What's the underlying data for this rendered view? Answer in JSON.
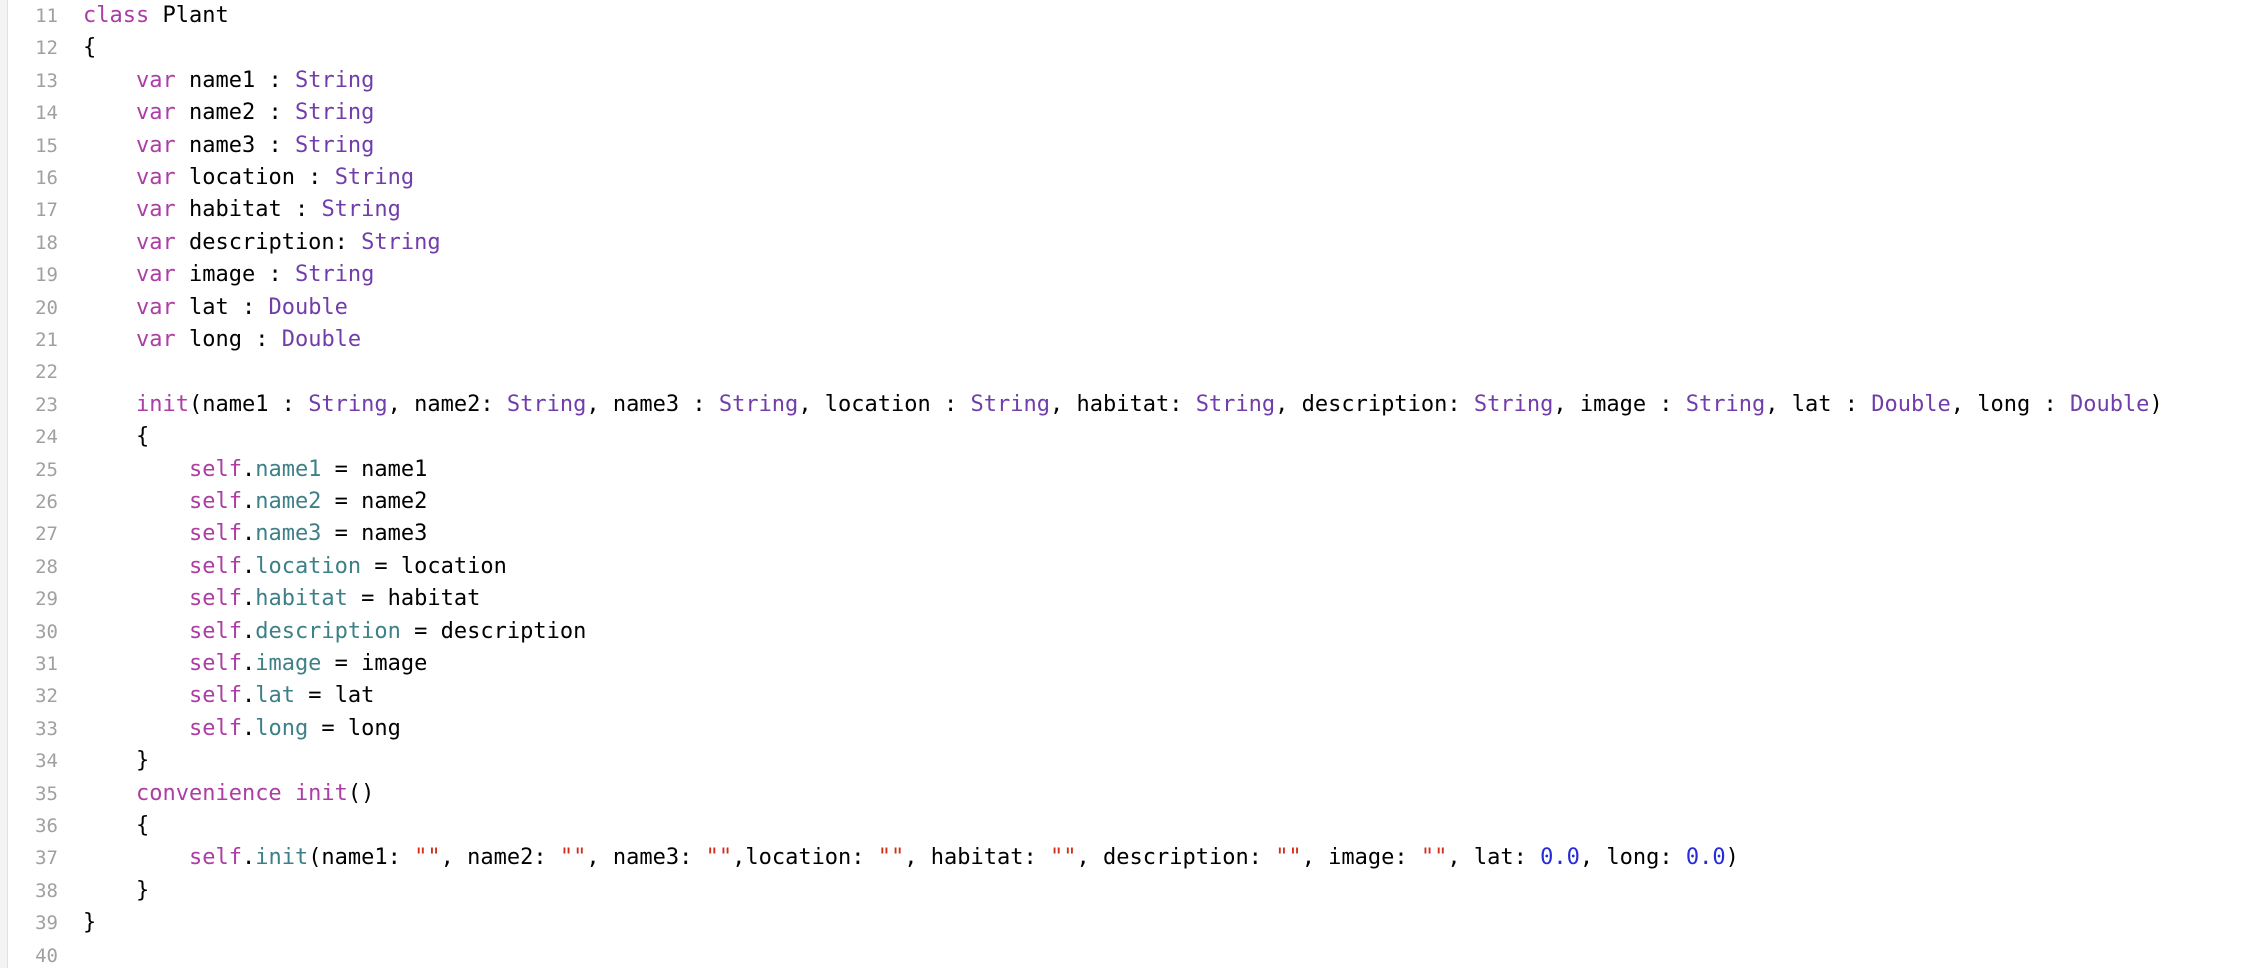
{
  "editor": {
    "colors": {
      "keyword": "#ad3da4",
      "type": "#703daa",
      "property": "#3e8087",
      "string": "#d12f1b",
      "number": "#272ad8",
      "plain": "#000000",
      "line_number": "#a0a0a0",
      "background": "#ffffff"
    },
    "lines": [
      {
        "num": "11",
        "indent": 0,
        "tokens": [
          {
            "t": "class",
            "c": "kw"
          },
          {
            "t": " Plant",
            "c": "pl"
          }
        ]
      },
      {
        "num": "12",
        "indent": 0,
        "tokens": [
          {
            "t": "{",
            "c": "pl"
          }
        ]
      },
      {
        "num": "13",
        "indent": 1,
        "tokens": [
          {
            "t": "var",
            "c": "kw"
          },
          {
            "t": " name1 : ",
            "c": "pl"
          },
          {
            "t": "String",
            "c": "ty"
          }
        ]
      },
      {
        "num": "14",
        "indent": 1,
        "tokens": [
          {
            "t": "var",
            "c": "kw"
          },
          {
            "t": " name2 : ",
            "c": "pl"
          },
          {
            "t": "String",
            "c": "ty"
          }
        ]
      },
      {
        "num": "15",
        "indent": 1,
        "tokens": [
          {
            "t": "var",
            "c": "kw"
          },
          {
            "t": " name3 : ",
            "c": "pl"
          },
          {
            "t": "String",
            "c": "ty"
          }
        ]
      },
      {
        "num": "16",
        "indent": 1,
        "tokens": [
          {
            "t": "var",
            "c": "kw"
          },
          {
            "t": " location : ",
            "c": "pl"
          },
          {
            "t": "String",
            "c": "ty"
          }
        ]
      },
      {
        "num": "17",
        "indent": 1,
        "tokens": [
          {
            "t": "var",
            "c": "kw"
          },
          {
            "t": " habitat : ",
            "c": "pl"
          },
          {
            "t": "String",
            "c": "ty"
          }
        ]
      },
      {
        "num": "18",
        "indent": 1,
        "tokens": [
          {
            "t": "var",
            "c": "kw"
          },
          {
            "t": " description: ",
            "c": "pl"
          },
          {
            "t": "String",
            "c": "ty"
          }
        ]
      },
      {
        "num": "19",
        "indent": 1,
        "tokens": [
          {
            "t": "var",
            "c": "kw"
          },
          {
            "t": " image : ",
            "c": "pl"
          },
          {
            "t": "String",
            "c": "ty"
          }
        ]
      },
      {
        "num": "20",
        "indent": 1,
        "tokens": [
          {
            "t": "var",
            "c": "kw"
          },
          {
            "t": " lat : ",
            "c": "pl"
          },
          {
            "t": "Double",
            "c": "ty"
          }
        ]
      },
      {
        "num": "21",
        "indent": 1,
        "tokens": [
          {
            "t": "var",
            "c": "kw"
          },
          {
            "t": " long : ",
            "c": "pl"
          },
          {
            "t": "Double",
            "c": "ty"
          }
        ]
      },
      {
        "num": "22",
        "indent": 0,
        "tokens": []
      },
      {
        "num": "23",
        "indent": 1,
        "tokens": [
          {
            "t": "init",
            "c": "kw"
          },
          {
            "t": "(name1 : ",
            "c": "pl"
          },
          {
            "t": "String",
            "c": "ty"
          },
          {
            "t": ", name2: ",
            "c": "pl"
          },
          {
            "t": "String",
            "c": "ty"
          },
          {
            "t": ", name3 : ",
            "c": "pl"
          },
          {
            "t": "String",
            "c": "ty"
          },
          {
            "t": ", location : ",
            "c": "pl"
          },
          {
            "t": "String",
            "c": "ty"
          },
          {
            "t": ", habitat: ",
            "c": "pl"
          },
          {
            "t": "String",
            "c": "ty"
          },
          {
            "t": ", description: ",
            "c": "pl"
          },
          {
            "t": "String",
            "c": "ty"
          },
          {
            "t": ", image : ",
            "c": "pl"
          },
          {
            "t": "String",
            "c": "ty"
          },
          {
            "t": ", lat : ",
            "c": "pl"
          },
          {
            "t": "Double",
            "c": "ty"
          },
          {
            "t": ", long : ",
            "c": "pl"
          },
          {
            "t": "Double",
            "c": "ty"
          },
          {
            "t": ")",
            "c": "pl"
          }
        ]
      },
      {
        "num": "24",
        "indent": 1,
        "tokens": [
          {
            "t": "{",
            "c": "pl"
          }
        ]
      },
      {
        "num": "25",
        "indent": 2,
        "tokens": [
          {
            "t": "self",
            "c": "kw"
          },
          {
            "t": ".",
            "c": "pl"
          },
          {
            "t": "name1",
            "c": "pr"
          },
          {
            "t": " = name1",
            "c": "pl"
          }
        ]
      },
      {
        "num": "26",
        "indent": 2,
        "tokens": [
          {
            "t": "self",
            "c": "kw"
          },
          {
            "t": ".",
            "c": "pl"
          },
          {
            "t": "name2",
            "c": "pr"
          },
          {
            "t": " = name2",
            "c": "pl"
          }
        ]
      },
      {
        "num": "27",
        "indent": 2,
        "tokens": [
          {
            "t": "self",
            "c": "kw"
          },
          {
            "t": ".",
            "c": "pl"
          },
          {
            "t": "name3",
            "c": "pr"
          },
          {
            "t": " = name3",
            "c": "pl"
          }
        ]
      },
      {
        "num": "28",
        "indent": 2,
        "tokens": [
          {
            "t": "self",
            "c": "kw"
          },
          {
            "t": ".",
            "c": "pl"
          },
          {
            "t": "location",
            "c": "pr"
          },
          {
            "t": " = location",
            "c": "pl"
          }
        ]
      },
      {
        "num": "29",
        "indent": 2,
        "tokens": [
          {
            "t": "self",
            "c": "kw"
          },
          {
            "t": ".",
            "c": "pl"
          },
          {
            "t": "habitat",
            "c": "pr"
          },
          {
            "t": " = habitat",
            "c": "pl"
          }
        ]
      },
      {
        "num": "30",
        "indent": 2,
        "tokens": [
          {
            "t": "self",
            "c": "kw"
          },
          {
            "t": ".",
            "c": "pl"
          },
          {
            "t": "description",
            "c": "pr"
          },
          {
            "t": " = description",
            "c": "pl"
          }
        ]
      },
      {
        "num": "31",
        "indent": 2,
        "tokens": [
          {
            "t": "self",
            "c": "kw"
          },
          {
            "t": ".",
            "c": "pl"
          },
          {
            "t": "image",
            "c": "pr"
          },
          {
            "t": " = image",
            "c": "pl"
          }
        ]
      },
      {
        "num": "32",
        "indent": 2,
        "tokens": [
          {
            "t": "self",
            "c": "kw"
          },
          {
            "t": ".",
            "c": "pl"
          },
          {
            "t": "lat",
            "c": "pr"
          },
          {
            "t": " = lat",
            "c": "pl"
          }
        ]
      },
      {
        "num": "33",
        "indent": 2,
        "tokens": [
          {
            "t": "self",
            "c": "kw"
          },
          {
            "t": ".",
            "c": "pl"
          },
          {
            "t": "long",
            "c": "pr"
          },
          {
            "t": " = long",
            "c": "pl"
          }
        ]
      },
      {
        "num": "34",
        "indent": 1,
        "tokens": [
          {
            "t": "}",
            "c": "pl"
          }
        ]
      },
      {
        "num": "35",
        "indent": 1,
        "tokens": [
          {
            "t": "convenience",
            "c": "kw"
          },
          {
            "t": " ",
            "c": "pl"
          },
          {
            "t": "init",
            "c": "kw"
          },
          {
            "t": "()",
            "c": "pl"
          }
        ]
      },
      {
        "num": "36",
        "indent": 1,
        "tokens": [
          {
            "t": "{",
            "c": "pl"
          }
        ]
      },
      {
        "num": "37",
        "indent": 2,
        "tokens": [
          {
            "t": "self",
            "c": "kw"
          },
          {
            "t": ".",
            "c": "pl"
          },
          {
            "t": "init",
            "c": "pr"
          },
          {
            "t": "(name1: ",
            "c": "pl"
          },
          {
            "t": "\"\"",
            "c": "st"
          },
          {
            "t": ", name2: ",
            "c": "pl"
          },
          {
            "t": "\"\"",
            "c": "st"
          },
          {
            "t": ", name3: ",
            "c": "pl"
          },
          {
            "t": "\"\"",
            "c": "st"
          },
          {
            "t": ",location: ",
            "c": "pl"
          },
          {
            "t": "\"\"",
            "c": "st"
          },
          {
            "t": ", habitat: ",
            "c": "pl"
          },
          {
            "t": "\"\"",
            "c": "st"
          },
          {
            "t": ", description: ",
            "c": "pl"
          },
          {
            "t": "\"\"",
            "c": "st"
          },
          {
            "t": ", image: ",
            "c": "pl"
          },
          {
            "t": "\"\"",
            "c": "st"
          },
          {
            "t": ", lat: ",
            "c": "pl"
          },
          {
            "t": "0.0",
            "c": "nu"
          },
          {
            "t": ", long: ",
            "c": "pl"
          },
          {
            "t": "0.0",
            "c": "nu"
          },
          {
            "t": ")",
            "c": "pl"
          }
        ]
      },
      {
        "num": "38",
        "indent": 1,
        "tokens": [
          {
            "t": "}",
            "c": "pl"
          }
        ]
      },
      {
        "num": "39",
        "indent": 0,
        "tokens": [
          {
            "t": "}",
            "c": "pl"
          }
        ]
      },
      {
        "num": "40",
        "indent": 0,
        "tokens": []
      }
    ]
  }
}
